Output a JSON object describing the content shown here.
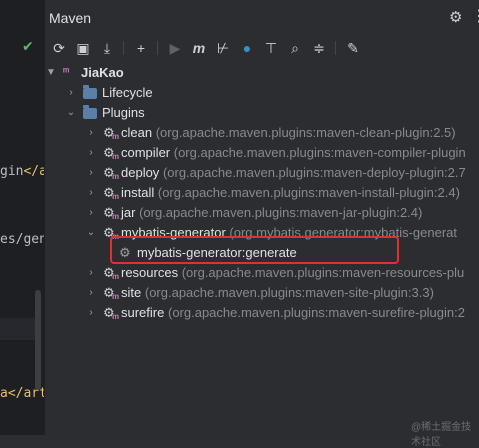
{
  "editor": {
    "fragments": [
      {
        "tag": "",
        "text": "gin"
      },
      {
        "tag": "</a",
        "text": ""
      },
      {
        "tag": "",
        "text": "es/gen"
      },
      {
        "tag": "a",
        "text": ""
      },
      {
        "tag": "</art",
        "text": ""
      }
    ]
  },
  "panel": {
    "title": "Maven",
    "settings_icon": "gear-icon",
    "more_icon": "more-vertical-icon"
  },
  "toolbar": {
    "items": [
      {
        "icon": "refresh-icon",
        "glyph": "⟳"
      },
      {
        "icon": "generate-sources-icon",
        "glyph": "📁"
      },
      {
        "icon": "download-icon",
        "glyph": "⤓"
      },
      {
        "icon": "add-icon",
        "glyph": "+"
      },
      {
        "icon": "run-icon",
        "glyph": "▶"
      },
      {
        "icon": "execute-goal-icon",
        "glyph": "m"
      },
      {
        "icon": "skip-tests-icon",
        "glyph": "⊬"
      },
      {
        "icon": "offline-mode-icon",
        "glyph": "⊕"
      },
      {
        "icon": "show-dependencies-icon",
        "glyph": "⊤"
      },
      {
        "icon": "search-icon",
        "glyph": "⌕"
      },
      {
        "icon": "collapse-all-icon",
        "glyph": "≑"
      },
      {
        "icon": "wrench-icon",
        "glyph": "🔧"
      }
    ]
  },
  "tree": {
    "root": {
      "label": "JiaKao"
    },
    "lifecycle": {
      "label": "Lifecycle"
    },
    "plugins": {
      "label": "Plugins"
    },
    "plugin_items": [
      {
        "name": "clean",
        "detail": "(org.apache.maven.plugins:maven-clean-plugin:2.5)"
      },
      {
        "name": "compiler",
        "detail": "(org.apache.maven.plugins:maven-compiler-plugin"
      },
      {
        "name": "deploy",
        "detail": "(org.apache.maven.plugins:maven-deploy-plugin:2.7"
      },
      {
        "name": "install",
        "detail": "(org.apache.maven.plugins:maven-install-plugin:2.4)"
      },
      {
        "name": "jar",
        "detail": "(org.apache.maven.plugins:maven-jar-plugin:2.4)"
      },
      {
        "name": "mybatis-generator",
        "detail": "(org.mybatis.generator:mybatis-generat"
      }
    ],
    "goal": {
      "label": "mybatis-generator:generate"
    },
    "plugin_items_after": [
      {
        "name": "resources",
        "detail": "(org.apache.maven.plugins:maven-resources-plu"
      },
      {
        "name": "site",
        "detail": "(org.apache.maven.plugins:maven-site-plugin:3.3)"
      },
      {
        "name": "surefire",
        "detail": "(org.apache.maven.plugins:maven-surefire-plugin:2"
      }
    ]
  },
  "watermark": "@稀土掘金技术社区",
  "colors": {
    "highlight_box": "#e0312f",
    "maven_m": "#c77dbb",
    "folder": "#5c7fa8"
  }
}
